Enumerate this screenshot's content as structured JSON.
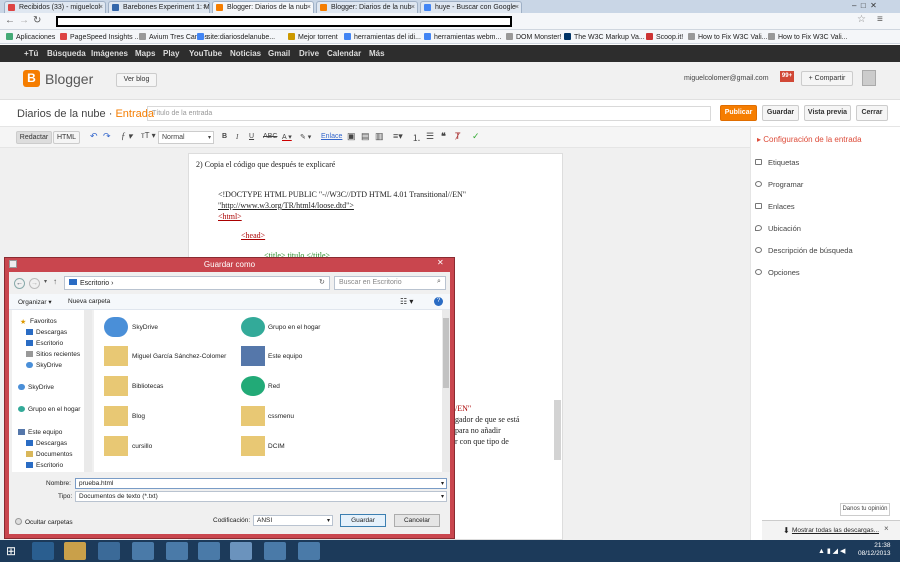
{
  "browser": {
    "tabs": [
      {
        "label": "Recibidos (33) - miguelcol",
        "color": "#d44"
      },
      {
        "label": "Barebones Experiment 1: M",
        "color": "#36a"
      },
      {
        "label": "Blogger: Diarios de la nub",
        "color": "#f57d00"
      },
      {
        "label": "Blogger: Diarios de la nub",
        "color": "#f57d00"
      },
      {
        "label": "huye - Buscar con Google",
        "color": "#4285f4"
      }
    ],
    "bookmarks": [
      "Aplicaciones",
      "PageSpeed Insights ...",
      "Avium Tres Cantos",
      "site:diariosdelanube...",
      "Mejor torrent",
      "herramientas del idi...",
      "herramientas webm...",
      "DOM Monster!",
      "The W3C Markup Va...",
      "Scoop.it!",
      "How to Fix W3C Vali...",
      "How to Fix W3C Vali..."
    ]
  },
  "google_bar": [
    "+Tú",
    "Búsqueda",
    "Imágenes",
    "Maps",
    "Play",
    "YouTube",
    "Noticias",
    "Gmail",
    "Drive",
    "Calendar",
    "Más"
  ],
  "blogger": {
    "logo_text": "Blogger",
    "view_blog": "Ver blog",
    "email": "miguelcolomer@gmail.com",
    "notif": "99+",
    "share": "Compartir",
    "blog_name": "Diarios de la nube",
    "separator": " · ",
    "entry": "Entrada",
    "title_placeholder": "Título de la entrada",
    "publish": "Publicar",
    "save": "Guardar",
    "preview": "Vista previa",
    "close": "Cerrar"
  },
  "format_bar": {
    "compose": "Redactar",
    "html": "HTML",
    "normal": "Normal",
    "link": "Enlace"
  },
  "editor": {
    "line1": "2) Copia el código que después te explicaré",
    "doctype": "<!DOCTYPE HTML PUBLIC \"-//W3C//DTD HTML 4.01 Transitional//EN\"",
    "dtd": "\"http://www.w3.org/TR/html4/loose.dtd\">",
    "html_tag": "<html>",
    "head_tag": "<head>",
    "title_line": "<title> titulo </title>",
    "frag1": "/EN\"",
    "frag2": "gador de que se está",
    "frag3": "para no añadir",
    "frag4": "r con que tipo de"
  },
  "right_panel": {
    "header": "Configuración de la entrada",
    "items": [
      "Etiquetas",
      "Programar",
      "Enlaces",
      "Ubicación",
      "Descripción de búsqueda",
      "Opciones"
    ],
    "feedback": "Danos tu opinión"
  },
  "dialog": {
    "title": "Guardar como",
    "path": "Escritorio",
    "search_placeholder": "Buscar en Escritorio",
    "organize": "Organizar",
    "new_folder": "Nueva carpeta",
    "nav": [
      "Favoritos",
      "Descargas",
      "Escritorio",
      "Sitios recientes",
      "SkyDrive",
      "SkyDrive",
      "Grupo en el hogar",
      "Este equipo",
      "Descargas",
      "Documentos",
      "Escritorio"
    ],
    "files": [
      "SkyDrive",
      "Grupo en el hogar",
      "Miguel García Sánchez-Colomer",
      "Este equipo",
      "Bibliotecas",
      "Red",
      "Blog",
      "cssmenu",
      "cursillo",
      "DCIM"
    ],
    "filename_label": "Nombre:",
    "filename": "prueba.html",
    "type_label": "Tipo:",
    "type": "Documentos de texto (*.txt)",
    "encoding_label": "Codificación:",
    "encoding": "ANSI",
    "save": "Guardar",
    "cancel": "Cancelar",
    "hide_folders": "Ocultar carpetas"
  },
  "downloads": {
    "show_all": "Mostrar todas las descargas..."
  },
  "taskbar": {
    "time": "21:38",
    "date": "08/12/2013"
  }
}
